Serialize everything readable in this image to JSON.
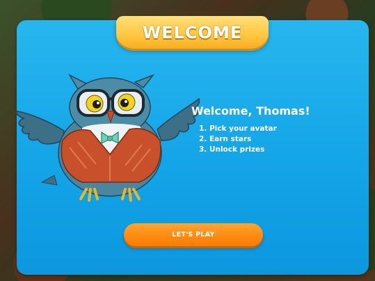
{
  "banner": {
    "title": "WELCOME"
  },
  "greeting": {
    "heading": "Welcome, Thomas!"
  },
  "steps": [
    "1. Pick your avatar",
    "2. Earn stars",
    "3. Unlock prizes"
  ],
  "play_button": {
    "label": "LET'S PLAY"
  },
  "mascot": {
    "icon": "owl-mascot-icon"
  },
  "colors": {
    "panel": "#14a5e8",
    "banner": "#ffc640",
    "play_button": "#ff8a10",
    "text": "#ffffff"
  }
}
